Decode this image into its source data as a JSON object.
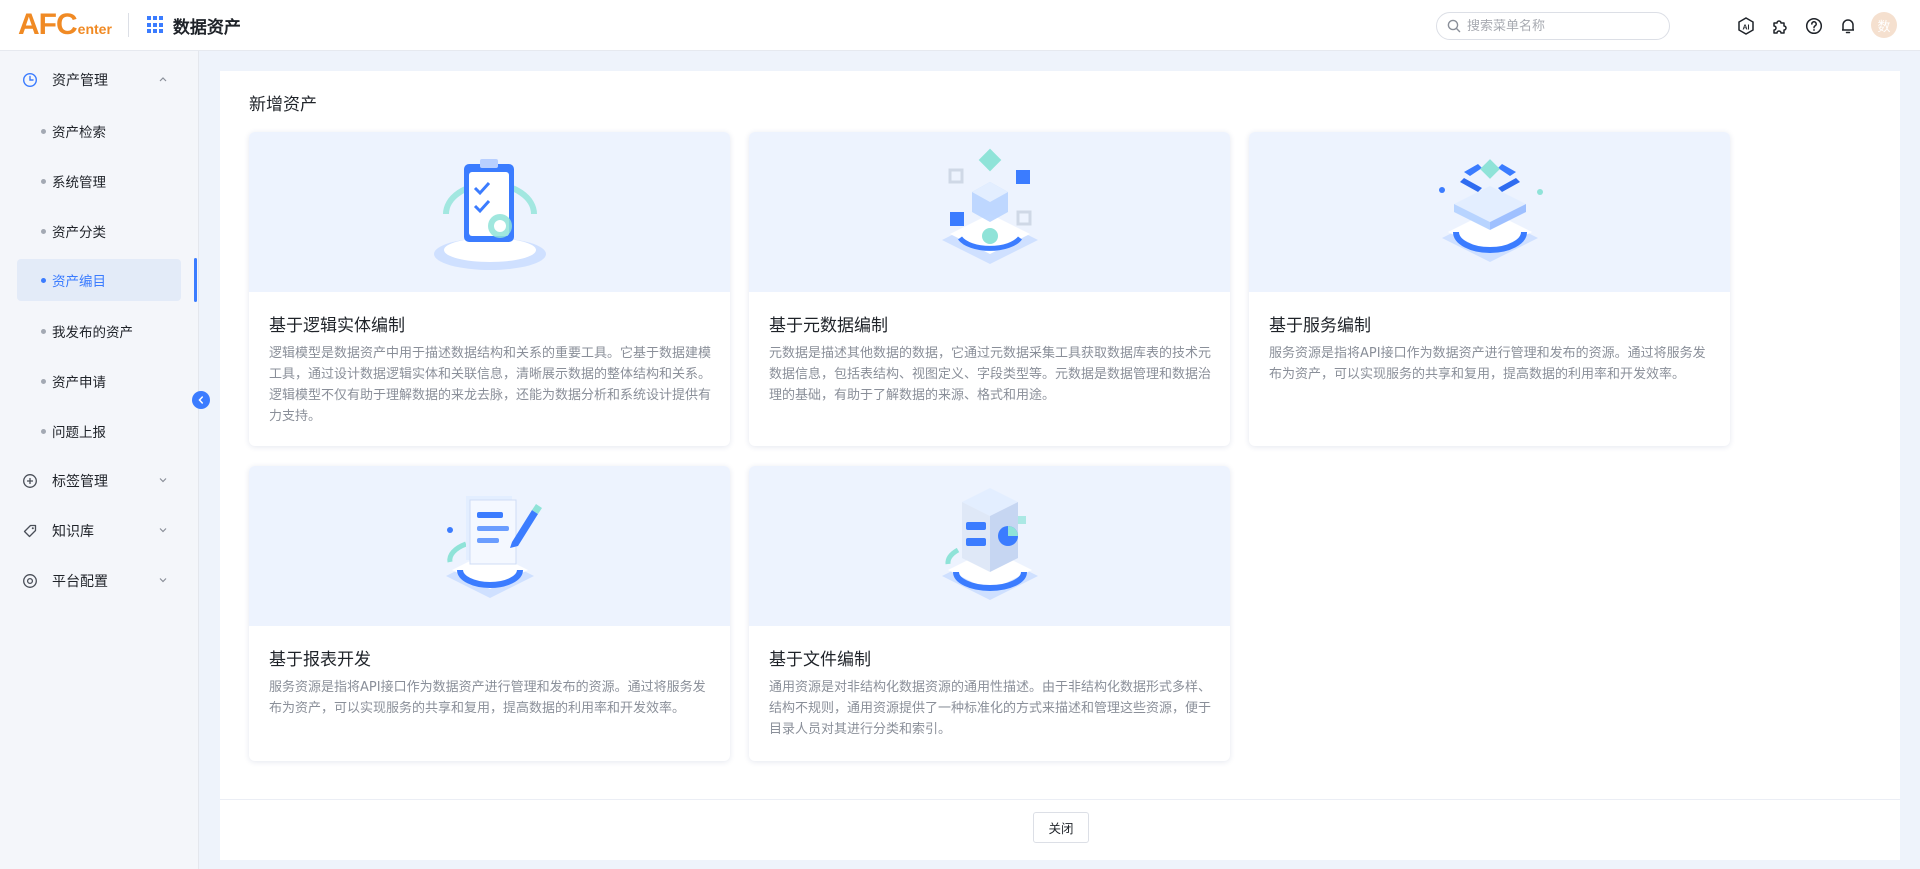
{
  "header": {
    "logo_big": "AFC",
    "logo_small": "enter",
    "title": "数据资产",
    "search_placeholder": "搜索菜单名称",
    "avatar_text": "数",
    "icons": [
      "ai-icon",
      "plugin-icon",
      "help-icon",
      "bell-icon"
    ]
  },
  "sidebar": {
    "groups": [
      {
        "label": "资产管理",
        "icon": "clock-icon",
        "expanded": true
      },
      {
        "label": "标签管理",
        "icon": "plus-circle-icon",
        "expanded": false
      },
      {
        "label": "知识库",
        "icon": "tag-icon",
        "expanded": false
      },
      {
        "label": "平台配置",
        "icon": "settings-icon",
        "expanded": false
      }
    ],
    "items": [
      {
        "label": "资产检索"
      },
      {
        "label": "系统管理"
      },
      {
        "label": "资产分类"
      },
      {
        "label": "资产编目",
        "active": true
      },
      {
        "label": "我发布的资产"
      },
      {
        "label": "资产申请"
      },
      {
        "label": "问题上报"
      }
    ]
  },
  "main": {
    "title": "新增资产",
    "cards": [
      {
        "title": "基于逻辑实体编制",
        "desc": "逻辑模型是数据资产中用于描述数据结构和关系的重要工具。它基于数据建模工具，通过设计数据逻辑实体和关联信息，清晰展示数据的整体结构和关系。逻辑模型不仅有助于理解数据的来龙去脉，还能为数据分析和系统设计提供有力支持。"
      },
      {
        "title": "基于元数据编制",
        "desc": "元数据是描述其他数据的数据，它通过元数据采集工具获取数据库表的技术元数据信息，包括表结构、视图定义、字段类型等。元数据是数据管理和数据治理的基础，有助于了解数据的来源、格式和用途。"
      },
      {
        "title": "基于服务编制",
        "desc": "服务资源是指将API接口作为数据资产进行管理和发布的资源。通过将服务发布为资产，可以实现服务的共享和复用，提高数据的利用率和开发效率。"
      },
      {
        "title": "基于报表开发",
        "desc": "服务资源是指将API接口作为数据资产进行管理和发布的资源。通过将服务发布为资产，可以实现服务的共享和复用，提高数据的利用率和开发效率。"
      },
      {
        "title": "基于文件编制",
        "desc": "通用资源是对非结构化数据资源的通用性描述。由于非结构化数据形式多样、结构不规则，通用资源提供了一种标准化的方式来描述和管理这些资源，便于目录人员对其进行分类和索引。"
      }
    ],
    "close_label": "关闭"
  },
  "colors": {
    "accent": "#3b7cff",
    "logo": "#f08a24",
    "card_bg": "#edf3fe"
  }
}
